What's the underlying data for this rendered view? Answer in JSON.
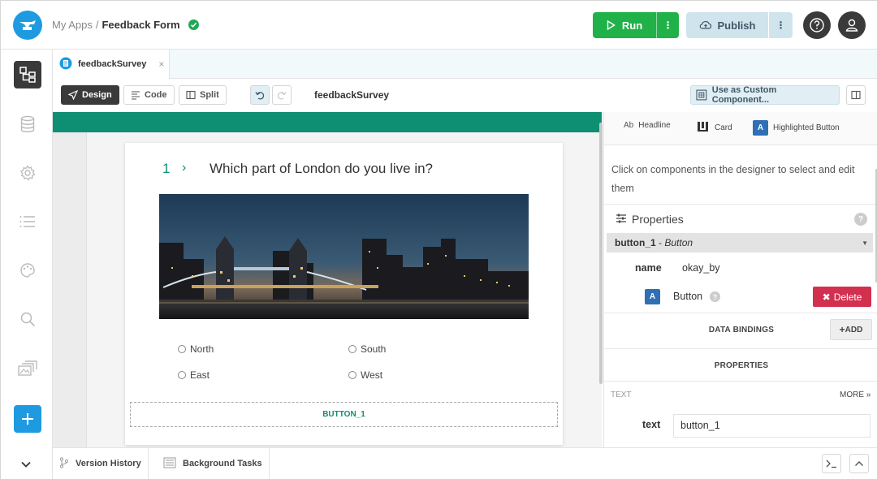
{
  "breadcrumb": {
    "root": "My Apps",
    "separator": "/",
    "current": "Feedback Form"
  },
  "header": {
    "run_label": "Run",
    "publish_label": "Publish"
  },
  "tab": {
    "name": "feedbackSurvey",
    "close": "×"
  },
  "toolbar": {
    "design": "Design",
    "code": "Code",
    "split": "Split",
    "form_name": "feedbackSurvey",
    "custom_component": "Use as Custom Component..."
  },
  "survey": {
    "question_number": "1",
    "question_arrow": "›",
    "question": "Which part of London do you live in?",
    "options": [
      "North",
      "South",
      "East",
      "West"
    ],
    "placeholder_button": "BUTTON_1"
  },
  "palette": [
    {
      "icon": "Ab",
      "label": "Headline"
    },
    {
      "icon": "card-icon",
      "label": "Card"
    },
    {
      "icon": "A",
      "label": "Highlighted Button"
    }
  ],
  "properties": {
    "hint": "Click on components in the designer to select and edit them",
    "title": "Properties",
    "help": "?",
    "component_name": "button_1",
    "component_dash": " - ",
    "component_type": "Button",
    "name_label": "name",
    "name_value": "okay_by",
    "type_badge": "A",
    "type_label": "Button",
    "delete_label": "Delete",
    "data_bindings": "DATA BINDINGS",
    "add_label": "ADD",
    "properties_section": "PROPERTIES",
    "text_group": "TEXT",
    "more_label": "MORE",
    "text_label": "text",
    "text_value": "button_1"
  },
  "bottom": {
    "version_history": "Version History",
    "background_tasks": "Background Tasks"
  },
  "colors": {
    "accent": "#1e9be0",
    "run": "#21b149",
    "survey_green": "#0e8f73",
    "delete": "#d1304f"
  }
}
